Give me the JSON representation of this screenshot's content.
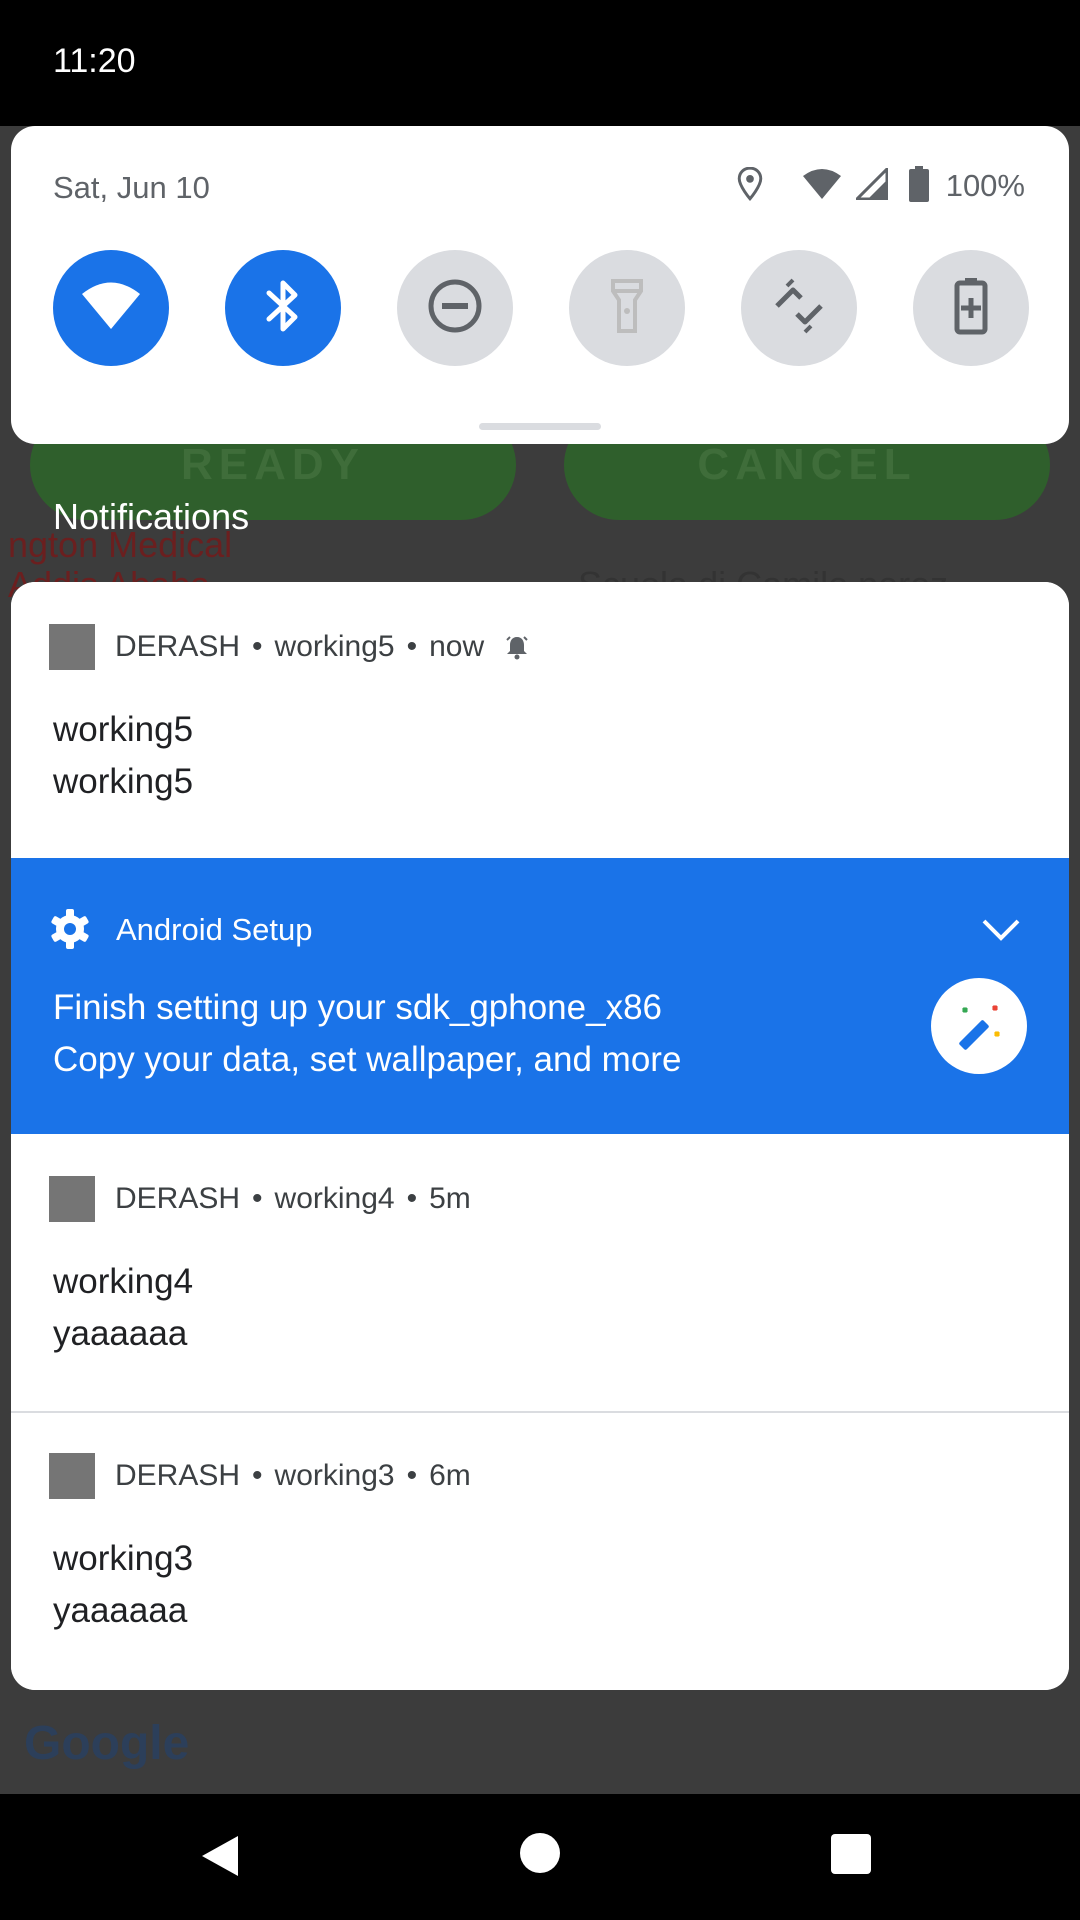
{
  "background": {
    "buttons": [
      "READY",
      "CANCEL"
    ],
    "map_labels": [
      "ngton Medical",
      "Addis Ababa",
      "Scuola di Camilo perez"
    ],
    "map_brand": "Google"
  },
  "status_bar": {
    "time": "11:20"
  },
  "quick_settings": {
    "date": "Sat, Jun 10",
    "battery_text": "100%",
    "status_icons": [
      "location-icon",
      "wifi-signal-icon",
      "cell-signal-icon",
      "battery-icon"
    ],
    "tiles": [
      {
        "name": "wifi",
        "icon": "wifi-icon",
        "state": "on"
      },
      {
        "name": "bluetooth",
        "icon": "bluetooth-icon",
        "state": "on"
      },
      {
        "name": "do-not-disturb",
        "icon": "dnd-icon",
        "state": "off"
      },
      {
        "name": "flashlight",
        "icon": "flashlight-icon",
        "state": "off"
      },
      {
        "name": "auto-rotate",
        "icon": "rotate-icon",
        "state": "off"
      },
      {
        "name": "battery-saver",
        "icon": "battery-saver-icon",
        "state": "off"
      }
    ]
  },
  "notifications_header": "Notifications",
  "notifications": [
    {
      "app": "DERASH",
      "sub": "working5",
      "time": "now",
      "title": "working5",
      "body": "working5",
      "alerting": true
    },
    {
      "app": "DERASH",
      "sub": "working4",
      "time": "5m",
      "title": "working4",
      "body": "yaaaaaa"
    },
    {
      "app": "DERASH",
      "sub": "working3",
      "time": "6m",
      "title": "working3",
      "body": "yaaaaaa"
    }
  ],
  "setup_notification": {
    "app": "Android Setup",
    "title": "Finish setting up your sdk_gphone_x86",
    "body": "Copy your data, set wallpaper, and more"
  },
  "colors": {
    "accent": "#1a73e8",
    "tile_off": "#dadce0",
    "icon_gray": "#5f6368",
    "panel": "#ffffff"
  },
  "nav_bar": [
    "back-icon",
    "home-icon",
    "recents-icon"
  ]
}
